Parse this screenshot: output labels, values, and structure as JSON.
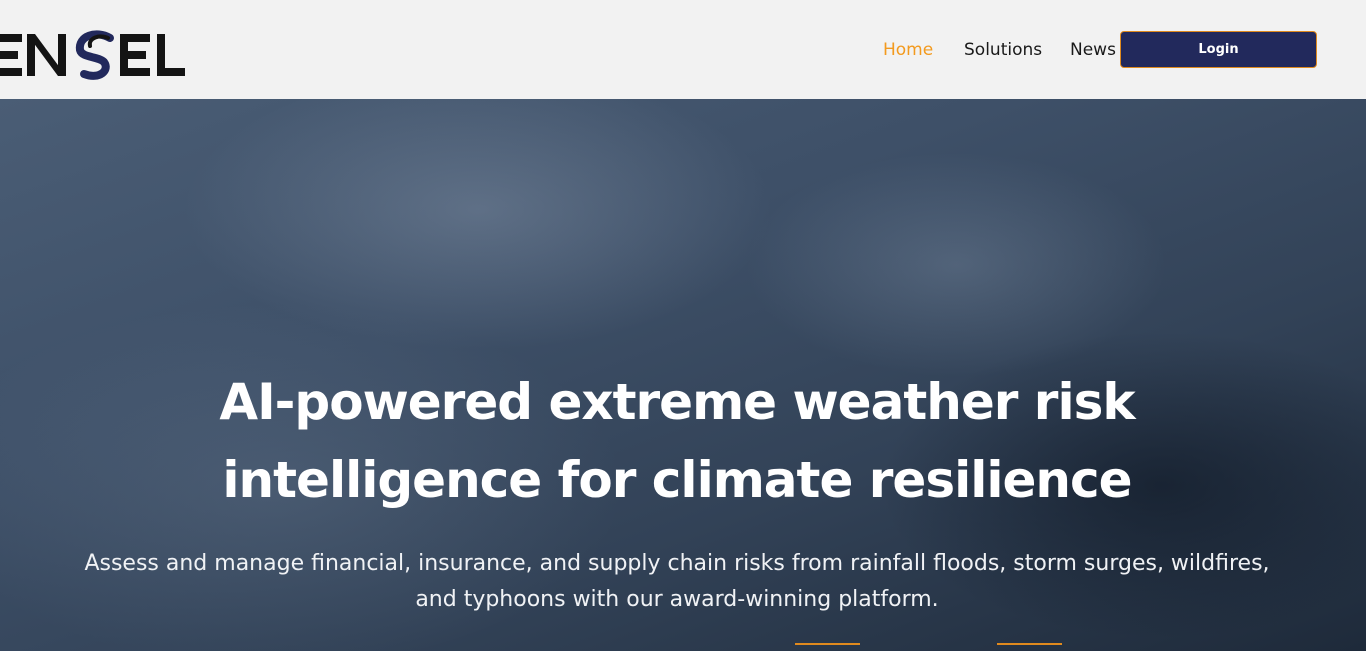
{
  "brand": {
    "logo_text": "ENSEL",
    "colors": {
      "logo_dark": "#141414",
      "logo_accent": "#22295c",
      "nav_active": "#f39a1e",
      "button_bg": "#22295c",
      "button_border": "#e08a1e"
    }
  },
  "nav": {
    "items": [
      {
        "label": "Home",
        "active": true
      },
      {
        "label": "Solutions",
        "active": false
      },
      {
        "label": "News & Insights",
        "active": false
      }
    ],
    "login_label": "Login"
  },
  "hero": {
    "title_line1": "AI-powered extreme weather risk",
    "title_line2": "intelligence for climate resilience",
    "subtitle_line1": "Assess and manage financial, insurance, and supply chain risks from rainfall floods, storm surges, wildfires,",
    "subtitle_line2": "and typhoons with our award-winning platform."
  }
}
